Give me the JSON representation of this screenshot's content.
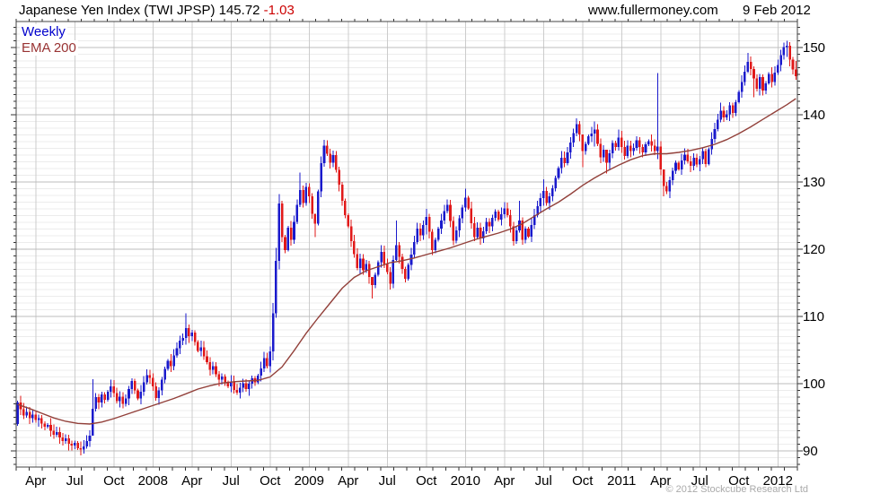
{
  "header": {
    "title": "Japanese Yen Index (TWI JPSP) 145.72",
    "change": "-1.03",
    "website": "www.fullermoney.com",
    "date": "9 Feb 2012"
  },
  "legend": {
    "weekly_label": "Weekly",
    "ema_label": "EMA 200"
  },
  "footer": {
    "copyright": "© 2012 Stockcube Research Ltd"
  },
  "colors": {
    "up_bar": "#1a1acc",
    "down_bar": "#e11919",
    "ema_line": "#92403a",
    "change_text": "#cc0000",
    "legend_weekly": "#0000cc",
    "legend_ema": "#993333",
    "grid_minor": "#ececec",
    "grid_major": "#bdbdbd",
    "grid_vertical": "#cccccc",
    "plot_border": "#444444",
    "tick": "#333333",
    "axis_text": "#000000",
    "copyright_text": "#aaaaaa"
  },
  "chart_data": {
    "type": "candlestick",
    "title": "Japanese Yen Index (TWI JPSP)",
    "frequency": "Weekly",
    "last_close": 145.72,
    "last_change": -1.03,
    "x_start": "Feb 2007",
    "x_end": "9 Feb 2012",
    "ylim": [
      87.6,
      153.9
    ],
    "y_ticks": [
      90,
      100,
      110,
      120,
      130,
      140,
      150
    ],
    "y_minor_step": 1,
    "grid": true,
    "legend_position": "top-left",
    "x_labels": [
      "Apr",
      "Jul",
      "Oct",
      "2008",
      "Apr",
      "Jul",
      "Oct",
      "2009",
      "Apr",
      "Jul",
      "Oct",
      "2010",
      "Apr",
      "Jul",
      "Oct",
      "2011",
      "Apr",
      "Jul",
      "Oct",
      "2012"
    ],
    "first_open": 94.0,
    "closes": [
      97.2,
      96.2,
      95.3,
      95.8,
      94.9,
      95.4,
      94.6,
      94.9,
      94.1,
      93.6,
      93.9,
      93.0,
      92.4,
      92.8,
      92.0,
      91.5,
      91.9,
      91.1,
      90.8,
      91.2,
      90.4,
      90.2,
      90.7,
      91.5,
      92.3,
      96.3,
      98.0,
      97.2,
      98.4,
      97.6,
      98.8,
      99.6,
      98.6,
      97.4,
      98.1,
      97.0,
      97.8,
      99.2,
      100.4,
      99.0,
      97.8,
      98.8,
      100.2,
      101.3,
      100.9,
      99.6,
      97.9,
      99.0,
      100.6,
      102.2,
      103.4,
      102.6,
      104.2,
      105.3,
      106.4,
      106.8,
      108.3,
      107.1,
      107.6,
      106.2,
      104.9,
      105.4,
      104.1,
      103.2,
      102.1,
      102.6,
      101.4,
      100.6,
      101.1,
      100.2,
      99.6,
      100.3,
      99.1,
      98.7,
      99.4,
      100.1,
      99.2,
      100.0,
      100.8,
      100.2,
      101.2,
      102.3,
      103.8,
      102.6,
      104.8,
      110.5,
      118.3,
      126.8,
      121.8,
      119.9,
      123.2,
      121.4,
      124.1,
      126.6,
      128.8,
      126.9,
      129.3,
      127.9,
      125.3,
      123.8,
      128.6,
      132.8,
      135.4,
      134.2,
      132.9,
      134.0,
      131.8,
      129.6,
      127.2,
      125.1,
      123.4,
      121.2,
      119.3,
      117.2,
      118.6,
      116.9,
      117.8,
      115.9,
      114.7,
      116.2,
      118.1,
      119.6,
      117.8,
      116.6,
      114.9,
      118.4,
      120.6,
      118.9,
      117.1,
      115.6,
      117.7,
      119.2,
      121.1,
      123.1,
      122.1,
      123.6,
      124.8,
      122.6,
      119.9,
      121.4,
      123.1,
      124.3,
      125.7,
      126.6,
      124.2,
      121.3,
      122.8,
      124.6,
      126.2,
      127.7,
      126.1,
      123.9,
      121.8,
      123.2,
      121.6,
      122.7,
      124.1,
      123.4,
      124.7,
      125.6,
      124.4,
      125.2,
      126.1,
      125.1,
      123.4,
      121.2,
      122.8,
      124.3,
      121.4,
      123.1,
      121.9,
      123.6,
      125.1,
      126.4,
      127.6,
      128.7,
      126.9,
      127.9,
      129.1,
      130.6,
      132.1,
      133.6,
      132.8,
      134.4,
      135.9,
      137.3,
      138.6,
      137.1,
      134.6,
      135.7,
      136.8,
      137.2,
      137.8,
      135.7,
      133.7,
      134.8,
      132.9,
      134.3,
      135.8,
      135.2,
      136.6,
      135.2,
      133.9,
      135.4,
      134.6,
      135.1,
      136.2,
      135.2,
      134.4,
      135.6,
      136.1,
      135.4,
      134.6,
      135.3,
      131.9,
      129.4,
      128.6,
      130.3,
      131.7,
      132.9,
      131.9,
      133.2,
      134.1,
      133.1,
      132.4,
      133.6,
      132.6,
      133.4,
      134.6,
      132.7,
      134.9,
      136.4,
      137.9,
      139.3,
      140.6,
      139.6,
      140.1,
      141.4,
      140.3,
      141.9,
      143.4,
      144.9,
      146.4,
      147.9,
      146.8,
      145.4,
      143.9,
      145.6,
      143.6,
      144.7,
      146.1,
      144.9,
      146.3,
      147.4,
      148.9,
      150.1,
      150.3,
      148.2,
      146.75,
      145.72
    ],
    "wick_overrides": {
      "25": [
        100.7,
        93.8
      ],
      "56": [
        110.5,
        105.8
      ],
      "85": [
        112.0,
        103.5
      ],
      "86": [
        120.2,
        109.8
      ],
      "87": [
        128.2,
        117.0
      ],
      "94": [
        131.4,
        126.3
      ],
      "99": [
        124.6,
        121.8
      ],
      "102": [
        136.3,
        132.3
      ],
      "118": [
        115.6,
        112.7
      ],
      "126": [
        124.3,
        118.3
      ],
      "136": [
        126.0,
        122.2
      ],
      "149": [
        129.0,
        125.6
      ],
      "167": [
        127.2,
        122.5
      ],
      "175": [
        130.4,
        126.5
      ],
      "186": [
        139.5,
        136.8
      ],
      "188": [
        136.6,
        132.2
      ],
      "192": [
        139.0,
        135.3
      ],
      "196": [
        134.2,
        131.3
      ],
      "200": [
        137.8,
        134.7
      ],
      "213": [
        146.2,
        133.4
      ],
      "215": [
        130.2,
        127.9
      ],
      "234": [
        141.8,
        138.9
      ],
      "243": [
        149.2,
        146.2
      ],
      "245": [
        147.2,
        142.6
      ],
      "256": [
        151.0,
        148.6
      ],
      "259": [
        148.0,
        145.2
      ]
    },
    "ema200": {
      "weeks": [
        0,
        4,
        8,
        12,
        16,
        20,
        24,
        28,
        32,
        36,
        40,
        44,
        48,
        52,
        56,
        60,
        64,
        68,
        72,
        76,
        80,
        84,
        88,
        92,
        96,
        100,
        104,
        108,
        112,
        116,
        120,
        124,
        128,
        132,
        136,
        140,
        144,
        148,
        152,
        156,
        160,
        164,
        168,
        172,
        176,
        180,
        184,
        188,
        192,
        196,
        200,
        204,
        208,
        212,
        216,
        220,
        224,
        228,
        232,
        236,
        240,
        244,
        248,
        252,
        256,
        259
      ],
      "values": [
        96.9,
        96.3,
        95.6,
        94.9,
        94.4,
        94.1,
        94.0,
        94.3,
        94.8,
        95.4,
        96.0,
        96.6,
        97.2,
        97.8,
        98.5,
        99.2,
        99.7,
        100.1,
        100.3,
        100.4,
        100.5,
        101.0,
        102.5,
        104.9,
        107.5,
        109.8,
        112.0,
        114.2,
        115.8,
        116.8,
        117.4,
        118.0,
        118.3,
        118.7,
        119.2,
        119.7,
        120.2,
        120.8,
        121.4,
        121.9,
        122.4,
        123.0,
        123.8,
        124.9,
        126.0,
        127.0,
        128.2,
        129.5,
        130.6,
        131.6,
        132.5,
        133.3,
        133.9,
        134.2,
        134.2,
        134.4,
        134.7,
        135.1,
        135.6,
        136.3,
        137.2,
        138.2,
        139.3,
        140.4,
        141.5,
        142.4
      ]
    }
  }
}
